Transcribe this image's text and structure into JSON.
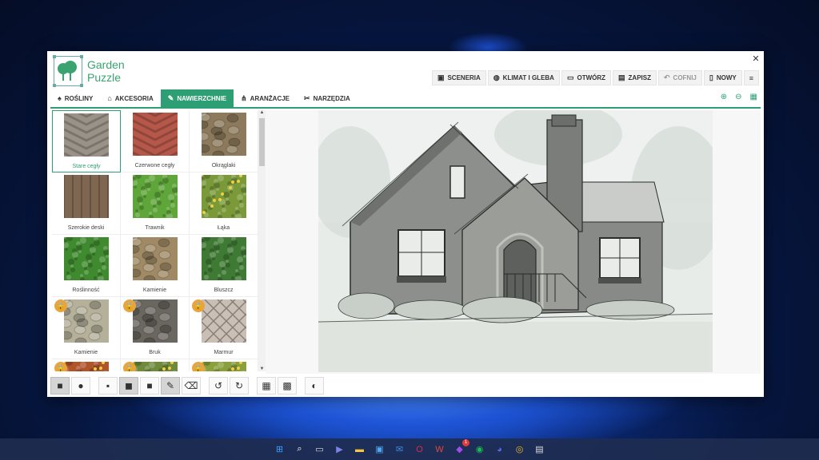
{
  "app": {
    "name_line1": "Garden",
    "name_line2": "Puzzle",
    "close_glyph": "✕"
  },
  "top_actions": [
    {
      "label": "SCENERIA",
      "icon": "image-icon",
      "glyph": "▣"
    },
    {
      "label": "KLIMAT I GLEBA",
      "icon": "globe-icon",
      "glyph": "◍"
    },
    {
      "label": "OTWÓRZ",
      "icon": "folder-open-icon",
      "glyph": "▭"
    },
    {
      "label": "ZAPISZ",
      "icon": "save-icon",
      "glyph": "▤"
    },
    {
      "label": "COFNIJ",
      "icon": "undo-icon",
      "glyph": "↶",
      "disabled": true
    },
    {
      "label": "NOWY",
      "icon": "new-file-icon",
      "glyph": "▯"
    },
    {
      "label": "",
      "icon": "menu-icon",
      "glyph": "≡"
    }
  ],
  "tabs": [
    {
      "label": "ROŚLINY",
      "icon": "bell-icon",
      "glyph": "♠"
    },
    {
      "label": "AKCESORIA",
      "icon": "home-icon",
      "glyph": "⌂"
    },
    {
      "label": "NAWIERZCHNIE",
      "icon": "brush-icon",
      "glyph": "✎",
      "active": true
    },
    {
      "label": "ARANŻACJE",
      "icon": "nodes-icon",
      "glyph": "⋔"
    },
    {
      "label": "NARZĘDZIA",
      "icon": "tools-icon",
      "glyph": "✂"
    }
  ],
  "zoom_tools": [
    {
      "icon": "zoom-in-icon",
      "glyph": "⊕"
    },
    {
      "icon": "zoom-out-icon",
      "glyph": "⊖"
    },
    {
      "icon": "calendar-icon",
      "glyph": "▦"
    }
  ],
  "textures": [
    {
      "label": "Stare cegły",
      "color": "#9a9289",
      "pattern": "herringbone-grey",
      "selected": true,
      "locked": false
    },
    {
      "label": "Czerwone cegły",
      "color": "#b5584a",
      "pattern": "herringbone-red",
      "locked": false
    },
    {
      "label": "Okrąglaki",
      "color": "#8d7a5c",
      "pattern": "cobble-brown",
      "locked": false
    },
    {
      "label": "Szerokie deski",
      "color": "#7e6650",
      "pattern": "planks",
      "locked": false
    },
    {
      "label": "Trawnik",
      "color": "#5fa63a",
      "pattern": "grass",
      "locked": false
    },
    {
      "label": "Łąka",
      "color": "#7a9a3a",
      "pattern": "meadow",
      "locked": false
    },
    {
      "label": "Roślinność",
      "color": "#3f8a2e",
      "pattern": "foliage",
      "locked": false
    },
    {
      "label": "Kamienie",
      "color": "#a08a66",
      "pattern": "flagstone",
      "locked": false
    },
    {
      "label": "Bluszcz",
      "color": "#3f7a34",
      "pattern": "ivy",
      "locked": false
    },
    {
      "label": "Kamienie",
      "color": "#b4b09a",
      "pattern": "stone-wall",
      "locked": true
    },
    {
      "label": "Bruk",
      "color": "#6a6660",
      "pattern": "paving",
      "locked": true
    },
    {
      "label": "Marmur",
      "color": "#c9bfb5",
      "pattern": "diamond",
      "locked": true
    },
    {
      "label": "",
      "color": "#b0542a",
      "pattern": "flowers-red",
      "locked": true
    },
    {
      "label": "",
      "color": "#6e8a3a",
      "pattern": "flowers-mixed",
      "locked": true
    },
    {
      "label": "",
      "color": "#8aa03c",
      "pattern": "flowers-yellow",
      "locked": true
    }
  ],
  "lock_glyph": "🔒",
  "scroll": {
    "up": "▲",
    "down": "▼"
  },
  "toolbar": [
    {
      "icon": "square-shape-icon",
      "glyph": "■",
      "active": true
    },
    {
      "icon": "circle-shape-icon",
      "glyph": "●"
    },
    {
      "sep": true
    },
    {
      "icon": "brush-small-icon",
      "glyph": "▪"
    },
    {
      "icon": "brush-medium-icon",
      "glyph": "◼",
      "active": true
    },
    {
      "icon": "brush-large-icon",
      "glyph": "■"
    },
    {
      "icon": "paint-brush-icon",
      "glyph": "✎",
      "active": true
    },
    {
      "icon": "eraser-icon",
      "glyph": "⌫"
    },
    {
      "sep": true
    },
    {
      "icon": "undo-icon",
      "glyph": "↺"
    },
    {
      "icon": "redo-icon",
      "glyph": "↻"
    },
    {
      "sep": true
    },
    {
      "icon": "grid-small-icon",
      "glyph": "▦"
    },
    {
      "icon": "grid-large-icon",
      "glyph": "▩"
    },
    {
      "sep": true
    },
    {
      "icon": "contrast-icon",
      "glyph": "◐"
    }
  ],
  "taskbar": [
    {
      "icon": "windows-start-icon",
      "glyph": "⊞",
      "color": "#3aa0ff"
    },
    {
      "icon": "search-icon",
      "glyph": "⌕",
      "color": "#ffffff"
    },
    {
      "icon": "task-view-icon",
      "glyph": "▭",
      "color": "#dddddd"
    },
    {
      "icon": "teams-chat-icon",
      "glyph": "▶",
      "color": "#7b83eb"
    },
    {
      "icon": "file-explorer-icon",
      "glyph": "▬",
      "color": "#f4c542"
    },
    {
      "icon": "store-icon",
      "glyph": "▣",
      "color": "#4fa8f0"
    },
    {
      "icon": "mail-icon",
      "glyph": "✉",
      "color": "#3a8ee6"
    },
    {
      "icon": "opera-icon",
      "glyph": "O",
      "color": "#e0294a"
    },
    {
      "icon": "office-icon",
      "glyph": "W",
      "color": "#e8483a"
    },
    {
      "icon": "messenger-icon",
      "glyph": "◆",
      "color": "#a24bf0",
      "badge": "1"
    },
    {
      "icon": "spotify-icon",
      "glyph": "◉",
      "color": "#1db954"
    },
    {
      "icon": "discord-icon",
      "glyph": "◕",
      "color": "#5865f2"
    },
    {
      "icon": "chrome-icon",
      "glyph": "◎",
      "color": "#e8b52a"
    },
    {
      "icon": "garden-puzzle-taskbar-icon",
      "glyph": "▤",
      "color": "#dddddd"
    }
  ]
}
